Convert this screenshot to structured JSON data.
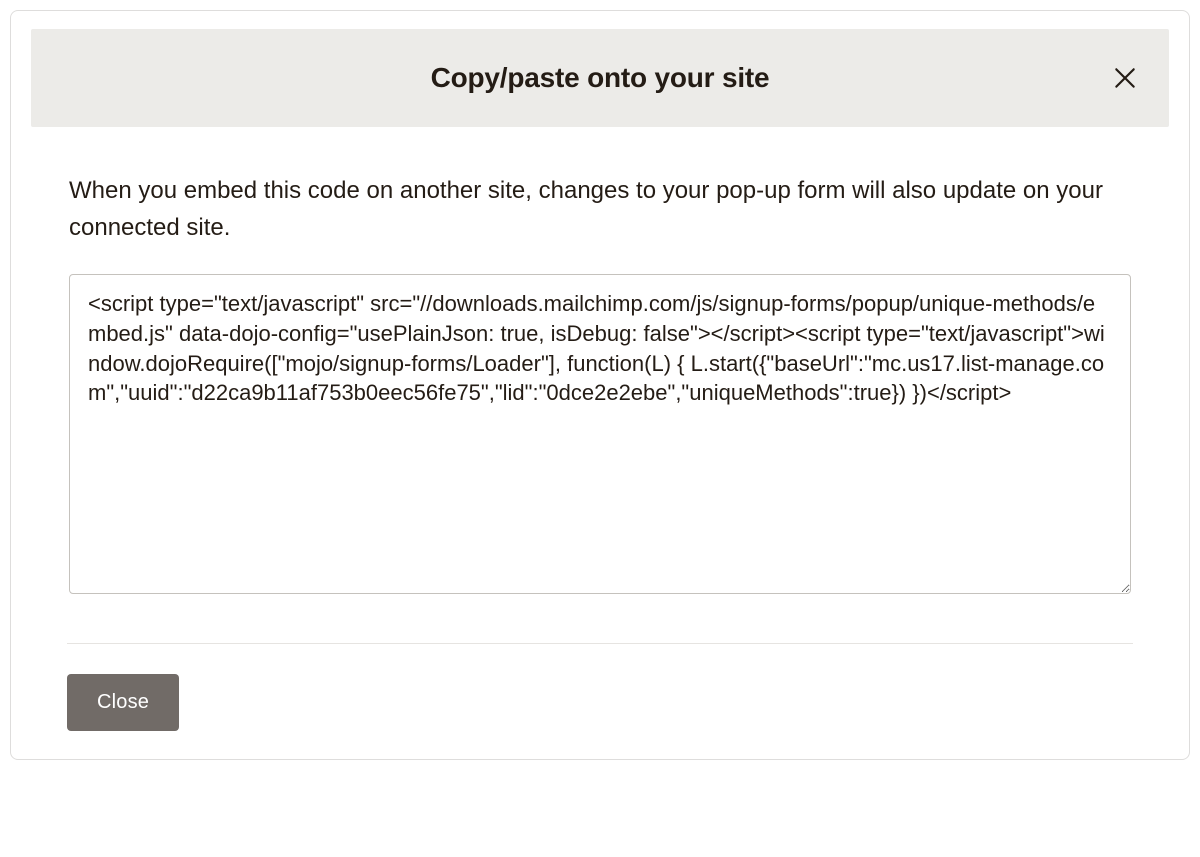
{
  "modal": {
    "title": "Copy/paste onto your site",
    "description": "When you embed this code on another site, changes to your pop-up form will also update on your connected site.",
    "code_snippet": "<script type=\"text/javascript\" src=\"//downloads.mailchimp.com/js/signup-forms/popup/unique-methods/embed.js\" data-dojo-config=\"usePlainJson: true, isDebug: false\"></script><script type=\"text/javascript\">window.dojoRequire([\"mojo/signup-forms/Loader\"], function(L) { L.start({\"baseUrl\":\"mc.us17.list-manage.com\",\"uuid\":\"d22ca9b11af753b0eec56fe75\",\"lid\":\"0dce2e2ebe\",\"uniqueMethods\":true}) })</script>",
    "close_button_label": "Close"
  }
}
